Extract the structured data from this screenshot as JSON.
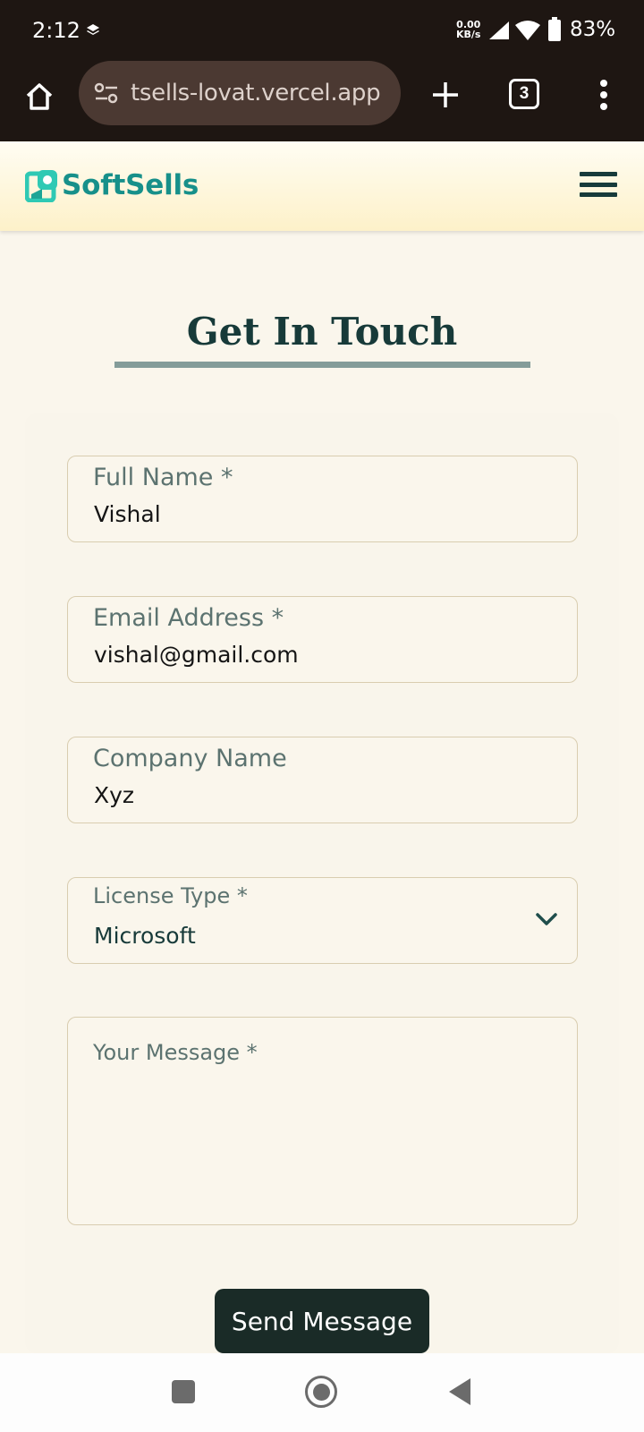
{
  "status_bar": {
    "time": "2:12",
    "net_speed_value": "0.00",
    "net_speed_unit": "KB/s",
    "battery": "83%",
    "icons": [
      "layers-icon",
      "signal-icon",
      "wifi-icon",
      "battery-icon"
    ]
  },
  "browser": {
    "url": "tsells-lovat.vercel.app",
    "tab_count": "3",
    "icons": [
      "home-icon",
      "site-settings-icon",
      "plus-icon",
      "tabs-icon",
      "more-vert-icon"
    ]
  },
  "site": {
    "brand": "SoftSells",
    "logo_color": "#17908a",
    "icons": [
      "logo-icon",
      "hamburger-menu-icon"
    ]
  },
  "page": {
    "title": "Get In Touch"
  },
  "form": {
    "full_name": {
      "label": "Full Name *",
      "value": "Vishal"
    },
    "email": {
      "label": "Email Address *",
      "value": "vishal@gmail.com"
    },
    "company": {
      "label": "Company Name",
      "value": "Xyz"
    },
    "license": {
      "label": "License Type *",
      "value": "Microsoft"
    },
    "message": {
      "label": "Your Message *",
      "value": ""
    },
    "submit_label": "Send Message"
  },
  "colors": {
    "primary_dark": "#173a39",
    "button_bg": "#1a2b27",
    "border": "#d9cdb0",
    "page_bg": "#faf6ec"
  },
  "nav_bar": {
    "icons": [
      "recent-apps-icon",
      "home-nav-icon",
      "back-icon"
    ]
  }
}
